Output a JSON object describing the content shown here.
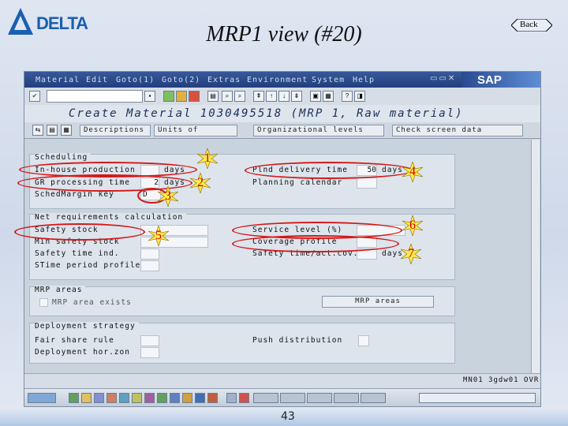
{
  "slide": {
    "logo_text": "DELTA",
    "title": "MRP1 view (#20)",
    "back_label": "Back",
    "page_number": "43"
  },
  "sap": {
    "menu": [
      "Material",
      "Edit",
      "Goto(1)",
      "Goto(2)",
      "Extras",
      "Environment",
      "System",
      "Help"
    ],
    "window_title": "Create Material 1030495518 (MRP 1, Raw material)",
    "app_toolbar": [
      "Descriptions",
      "Units of measure",
      "Organizational levels",
      "Check screen data"
    ],
    "groups": {
      "scheduling": {
        "title": "Scheduling",
        "inhouse_label": "In-house production",
        "inhouse_unit": "days",
        "gr_label": "GR processing time",
        "gr_value": "2",
        "gr_unit": "days",
        "schedmargin_label": "SchedMargin key",
        "schedmargin_value": "D",
        "plnd_label": "Plnd delivery time",
        "plnd_value": "50",
        "plnd_unit": "days",
        "planning_calendar_label": "Planning calendar"
      },
      "net_req": {
        "title": "Net requirements calculation",
        "safety_stock_label": "Safety stock",
        "min_safety_label": "Min safety stock",
        "safety_time_ind_label": "Safety time ind.",
        "stime_period_label": "STime period profile",
        "service_level_label": "Service level (%)",
        "coverage_profile_label": "Coverage profile",
        "safety_time_label": "Safety time/act.cov.",
        "safety_time_unit": "days"
      },
      "mrp_areas": {
        "title": "MRP areas",
        "checkbox_label": "MRP area exists",
        "button_label": "MRP areas"
      },
      "deployment": {
        "title": "Deployment strategy",
        "fair_share_label": "Fair share rule",
        "deployment_hor_label": "Deployment hor.zon",
        "push_label": "Push distribution"
      }
    },
    "status_text": "MN01 3gdw01 OVR"
  },
  "markers": [
    "1",
    "2",
    "3",
    "4",
    "5",
    "6",
    "7"
  ],
  "colors": {
    "marker_red": "#d41818",
    "sap_blue": "#233f7d"
  }
}
